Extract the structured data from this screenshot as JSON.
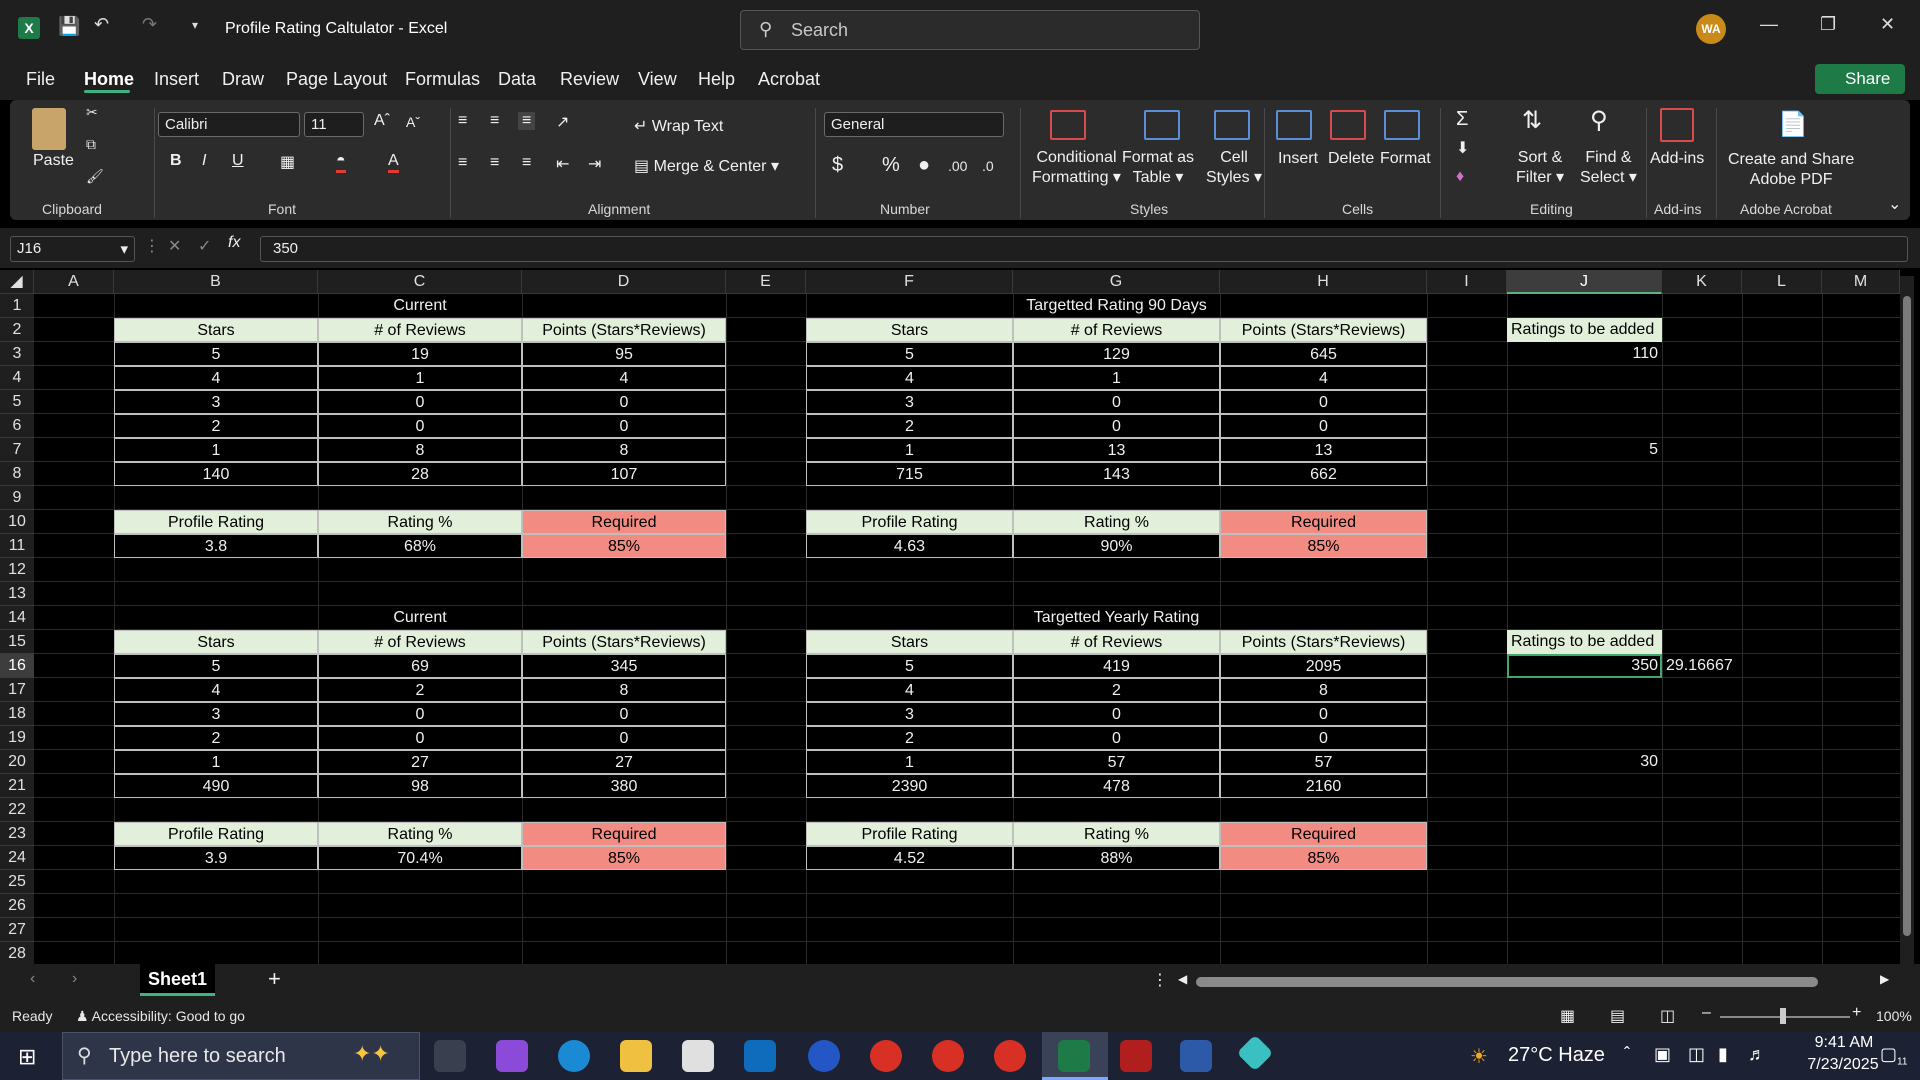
{
  "window": {
    "title": "Profile Rating Caltulator  -  Excel",
    "search_placeholder": "Search",
    "avatar_initials": "WA"
  },
  "menu": [
    "File",
    "Home",
    "Insert",
    "Draw",
    "Page Layout",
    "Formulas",
    "Data",
    "Review",
    "View",
    "Help",
    "Acrobat"
  ],
  "share_label": "Share",
  "ribbon": {
    "clipboard": {
      "paste": "Paste",
      "label": "Clipboard"
    },
    "font": {
      "name": "Calibri",
      "size": "11",
      "label": "Font"
    },
    "alignment": {
      "wrap": "Wrap Text",
      "merge": "Merge & Center",
      "label": "Alignment"
    },
    "number": {
      "format": "General",
      "label": "Number"
    },
    "styles": {
      "cond": "Conditional",
      "cond2": "Formatting",
      "fmt_table": "Format as",
      "fmt_table2": "Table",
      "cell_styles": "Cell",
      "cell_styles2": "Styles",
      "label": "Styles"
    },
    "cells": {
      "insert": "Insert",
      "delete": "Delete",
      "format": "Format",
      "label": "Cells"
    },
    "editing": {
      "sort": "Sort &",
      "sort2": "Filter",
      "find": "Find &",
      "find2": "Select",
      "label": "Editing"
    },
    "addins": {
      "btn": "Add-ins",
      "label": "Add-ins"
    },
    "acrobat": {
      "btn1": "Create and Share",
      "btn2": "Adobe PDF",
      "label": "Adobe Acrobat"
    }
  },
  "formula_bar": {
    "name_box": "J16",
    "value": "350"
  },
  "columns": [
    "A",
    "B",
    "C",
    "D",
    "E",
    "F",
    "G",
    "H",
    "I",
    "J",
    "K",
    "L",
    "M"
  ],
  "rows": [
    "1",
    "2",
    "3",
    "4",
    "5",
    "6",
    "7",
    "8",
    "9",
    "10",
    "11",
    "12",
    "13",
    "14",
    "15",
    "16",
    "17",
    "18",
    "19",
    "20",
    "21",
    "22",
    "23",
    "24",
    "25",
    "26",
    "27",
    "28"
  ],
  "sheet": {
    "t1": {
      "title": "Current",
      "headers": [
        "Stars",
        "# of Reviews",
        "Points (Stars*Reviews)"
      ],
      "rows": [
        [
          "5",
          "19",
          "95"
        ],
        [
          "4",
          "1",
          "4"
        ],
        [
          "3",
          "0",
          "0"
        ],
        [
          "2",
          "0",
          "0"
        ],
        [
          "1",
          "8",
          "8"
        ],
        [
          "140",
          "28",
          "107"
        ]
      ],
      "summary_headers": [
        "Profile Rating",
        "Rating %",
        "Required"
      ],
      "summary": [
        "3.8",
        "68%",
        "85%"
      ]
    },
    "t2": {
      "title": "Targetted Rating 90 Days",
      "headers": [
        "Stars",
        "# of Reviews",
        "Points (Stars*Reviews)"
      ],
      "rows": [
        [
          "5",
          "129",
          "645"
        ],
        [
          "4",
          "1",
          "4"
        ],
        [
          "3",
          "0",
          "0"
        ],
        [
          "2",
          "0",
          "0"
        ],
        [
          "1",
          "13",
          "13"
        ],
        [
          "715",
          "143",
          "662"
        ]
      ],
      "summary_headers": [
        "Profile Rating",
        "Rating %",
        "Required"
      ],
      "summary": [
        "4.63",
        "90%",
        "85%"
      ]
    },
    "t3": {
      "title": "Current",
      "headers": [
        "Stars",
        "# of Reviews",
        "Points (Stars*Reviews)"
      ],
      "rows": [
        [
          "5",
          "69",
          "345"
        ],
        [
          "4",
          "2",
          "8"
        ],
        [
          "3",
          "0",
          "0"
        ],
        [
          "2",
          "0",
          "0"
        ],
        [
          "1",
          "27",
          "27"
        ],
        [
          "490",
          "98",
          "380"
        ]
      ],
      "summary_headers": [
        "Profile Rating",
        "Rating %",
        "Required"
      ],
      "summary": [
        "3.9",
        "70.4%",
        "85%"
      ]
    },
    "t4": {
      "title": "Targetted Yearly Rating",
      "headers": [
        "Stars",
        "# of Reviews",
        "Points (Stars*Reviews)"
      ],
      "rows": [
        [
          "5",
          "419",
          "2095"
        ],
        [
          "4",
          "2",
          "8"
        ],
        [
          "3",
          "0",
          "0"
        ],
        [
          "2",
          "0",
          "0"
        ],
        [
          "1",
          "57",
          "57"
        ],
        [
          "2390",
          "478",
          "2160"
        ]
      ],
      "summary_headers": [
        "Profile Rating",
        "Rating %",
        "Required"
      ],
      "summary": [
        "4.52",
        "88%",
        "85%"
      ]
    },
    "side1": {
      "header": "Ratings to be added",
      "v1": "110",
      "v2": "5"
    },
    "side2": {
      "header": "Ratings to be added",
      "v1": "350",
      "k16": "29.16667",
      "v2": "30"
    }
  },
  "sheet_tab": "Sheet1",
  "status": {
    "ready": "Ready",
    "accessibility": "Accessibility: Good to go",
    "zoom": "100%"
  },
  "taskbar": {
    "search_placeholder": "Type here to search",
    "weather": "27°C  Haze",
    "time": "9:41 AM",
    "date": "7/23/2025",
    "notif": "11"
  },
  "colors": {
    "accent": "#3fb27f",
    "header_green": "#e2efda",
    "required_red": "#f28b82"
  }
}
